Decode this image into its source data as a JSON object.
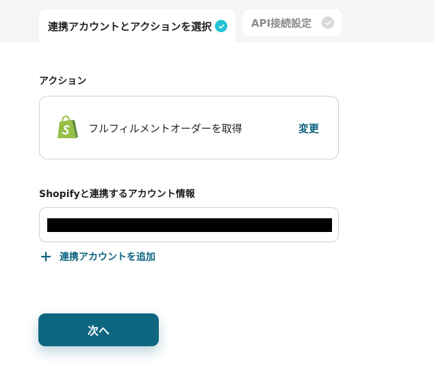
{
  "tabs": [
    {
      "label": "連携アカウントとアクションを選択",
      "status": "complete",
      "active": true,
      "check_color": "#22c3d6"
    },
    {
      "label": "API接続設定",
      "status": "pending",
      "active": false,
      "check_color": "#d8d8d8"
    }
  ],
  "action_section": {
    "heading": "アクション",
    "app_icon": "shopify-icon",
    "action_name": "フルフィルメントオーダーを取得",
    "change_label": "変更"
  },
  "account_section": {
    "heading": "Shopifyと連携するアカウント情報",
    "selected_account": "[redacted]",
    "add_account_label": "連携アカウントを追加"
  },
  "next_button": {
    "label": "次へ"
  },
  "colors": {
    "accent": "#0f6680",
    "link": "#0c6380",
    "check_active": "#22c3d6",
    "shopify_green": "#95bf47"
  }
}
